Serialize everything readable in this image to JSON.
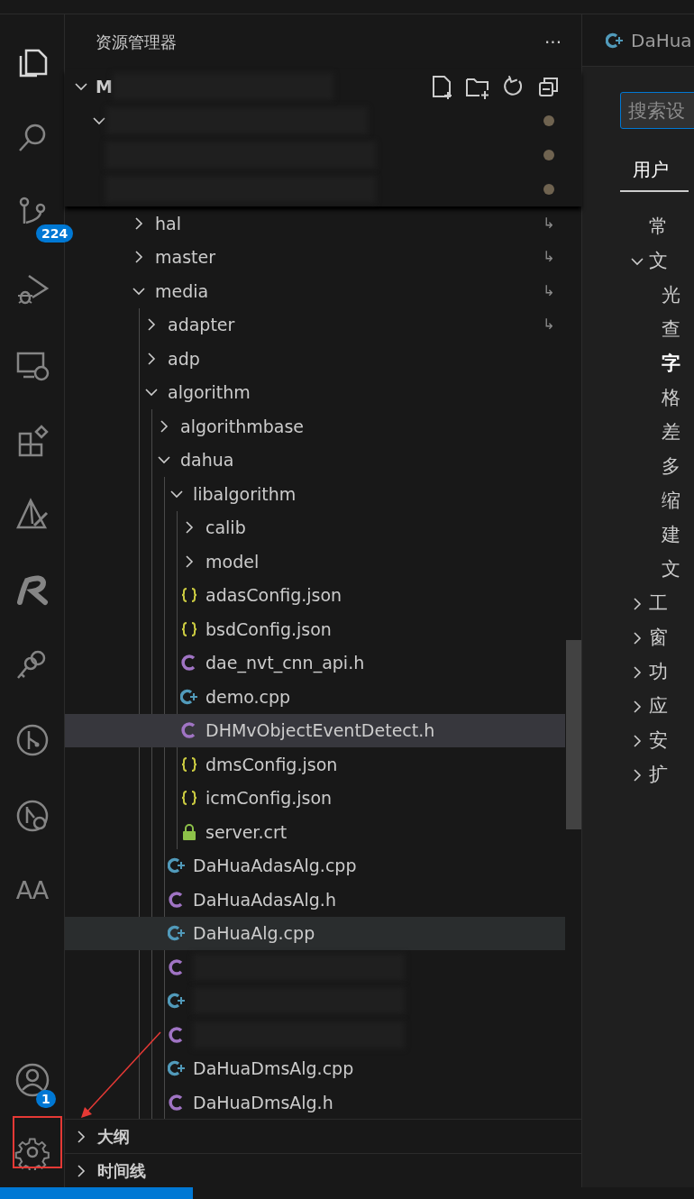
{
  "activity_bar": {
    "items": [
      {
        "kind": "files",
        "selected": true
      },
      {
        "kind": "search",
        "selected": false
      },
      {
        "kind": "source-control",
        "selected": false,
        "badge": "224"
      },
      {
        "kind": "run-debug",
        "selected": false
      },
      {
        "kind": "remote",
        "selected": false
      },
      {
        "kind": "extensions",
        "selected": false
      },
      {
        "kind": "triangle-tool",
        "selected": false
      },
      {
        "kind": "r-logo",
        "selected": false
      },
      {
        "kind": "keys",
        "selected": false
      },
      {
        "kind": "git-graph",
        "selected": false
      },
      {
        "kind": "git-search",
        "selected": false
      },
      {
        "kind": "text",
        "selected": false,
        "label": "AA"
      }
    ],
    "bottom_items": [
      {
        "kind": "account",
        "badge": "1"
      },
      {
        "kind": "settings"
      }
    ]
  },
  "explorer": {
    "title": "资源管理器",
    "more": "···",
    "root": {
      "label": "M",
      "expanded": true
    },
    "sticky_rows": [
      {
        "expanded": true
      },
      {
        "expanded": null
      },
      {
        "expanded": null
      }
    ],
    "tree": [
      {
        "label": "hal",
        "kind": "folder",
        "expanded": false,
        "selected": false,
        "hovered": false,
        "decoration": "↳"
      },
      {
        "label": "master",
        "kind": "folder",
        "expanded": false,
        "selected": false,
        "hovered": false,
        "decoration": "↳"
      },
      {
        "label": "media",
        "kind": "folder",
        "expanded": true,
        "selected": false,
        "hovered": false,
        "decoration": "↳",
        "children": [
          {
            "label": "adapter",
            "kind": "folder",
            "expanded": false,
            "selected": false,
            "hovered": false,
            "decoration": "↳"
          },
          {
            "label": "adp",
            "kind": "folder",
            "expanded": false,
            "selected": false,
            "hovered": false
          },
          {
            "label": "algorithm",
            "kind": "folder",
            "expanded": true,
            "selected": false,
            "hovered": false,
            "children": [
              {
                "label": "algorithmbase",
                "kind": "folder",
                "expanded": false,
                "selected": false,
                "hovered": false
              },
              {
                "label": "dahua",
                "kind": "folder",
                "expanded": true,
                "selected": false,
                "hovered": false,
                "children": [
                  {
                    "label": "libalgorithm",
                    "kind": "folder",
                    "expanded": true,
                    "selected": false,
                    "hovered": false,
                    "children": [
                      {
                        "label": "calib",
                        "kind": "folder",
                        "expanded": false,
                        "selected": false,
                        "hovered": false
                      },
                      {
                        "label": "model",
                        "kind": "folder",
                        "expanded": false,
                        "selected": false,
                        "hovered": false
                      },
                      {
                        "label": "adasConfig.json",
                        "kind": "json",
                        "selected": false,
                        "hovered": false
                      },
                      {
                        "label": "bsdConfig.json",
                        "kind": "json",
                        "selected": false,
                        "hovered": false
                      },
                      {
                        "label": "dae_nvt_cnn_api.h",
                        "kind": "c",
                        "selected": false,
                        "hovered": false
                      },
                      {
                        "label": "demo.cpp",
                        "kind": "cpp",
                        "selected": false,
                        "hovered": false
                      },
                      {
                        "label": "DHMvObjectEventDetect.h",
                        "kind": "c",
                        "selected": true,
                        "hovered": false
                      },
                      {
                        "label": "dmsConfig.json",
                        "kind": "json",
                        "selected": false,
                        "hovered": false
                      },
                      {
                        "label": "icmConfig.json",
                        "kind": "json",
                        "selected": false,
                        "hovered": false
                      },
                      {
                        "label": "server.crt",
                        "kind": "cert",
                        "selected": false,
                        "hovered": false
                      }
                    ]
                  },
                  {
                    "label": "DaHuaAdasAlg.cpp",
                    "kind": "cpp",
                    "selected": false,
                    "hovered": false
                  },
                  {
                    "label": "DaHuaAdasAlg.h",
                    "kind": "c",
                    "selected": false,
                    "hovered": false
                  },
                  {
                    "label": "DaHuaAlg.cpp",
                    "kind": "cpp",
                    "selected": false,
                    "hovered": true
                  },
                  {
                    "kind": "c",
                    "selected": false,
                    "hovered": false
                  },
                  {
                    "kind": "cpp",
                    "selected": false,
                    "hovered": false
                  },
                  {
                    "kind": "c",
                    "selected": false,
                    "hovered": false
                  },
                  {
                    "label": "DaHuaDmsAlg.cpp",
                    "kind": "cpp",
                    "selected": false,
                    "hovered": false
                  },
                  {
                    "label": "DaHuaDmsAlg.h",
                    "kind": "c",
                    "selected": false,
                    "hovered": false
                  }
                ]
              }
            ]
          }
        ]
      }
    ]
  },
  "panels": [
    {
      "label": "大纲",
      "expanded": false
    },
    {
      "label": "时间线",
      "expanded": false
    }
  ],
  "editor": {
    "tab": {
      "label": "DaHua",
      "kind": "cpp"
    },
    "search": {
      "placeholder": "搜索设"
    },
    "scope_tab": {
      "label": "用户",
      "selected": true
    },
    "toc": [
      {
        "label": "常",
        "kind": "leaf"
      },
      {
        "label": "文",
        "kind": "group",
        "expanded": true,
        "children": [
          {
            "label": "光",
            "selected": false
          },
          {
            "label": "查",
            "selected": false
          },
          {
            "label": "字",
            "selected": true
          },
          {
            "label": "格",
            "selected": false
          },
          {
            "label": "差",
            "selected": false
          },
          {
            "label": "多",
            "selected": false
          },
          {
            "label": "缩",
            "selected": false
          },
          {
            "label": "建",
            "selected": false
          },
          {
            "label": "文",
            "selected": false
          }
        ]
      },
      {
        "label": "工",
        "kind": "group",
        "expanded": false
      },
      {
        "label": "窗",
        "kind": "group",
        "expanded": false
      },
      {
        "label": "功",
        "kind": "group",
        "expanded": false
      },
      {
        "label": "应",
        "kind": "group",
        "expanded": false
      },
      {
        "label": "安",
        "kind": "group",
        "expanded": false
      },
      {
        "label": "扩",
        "kind": "group",
        "expanded": false
      }
    ]
  }
}
